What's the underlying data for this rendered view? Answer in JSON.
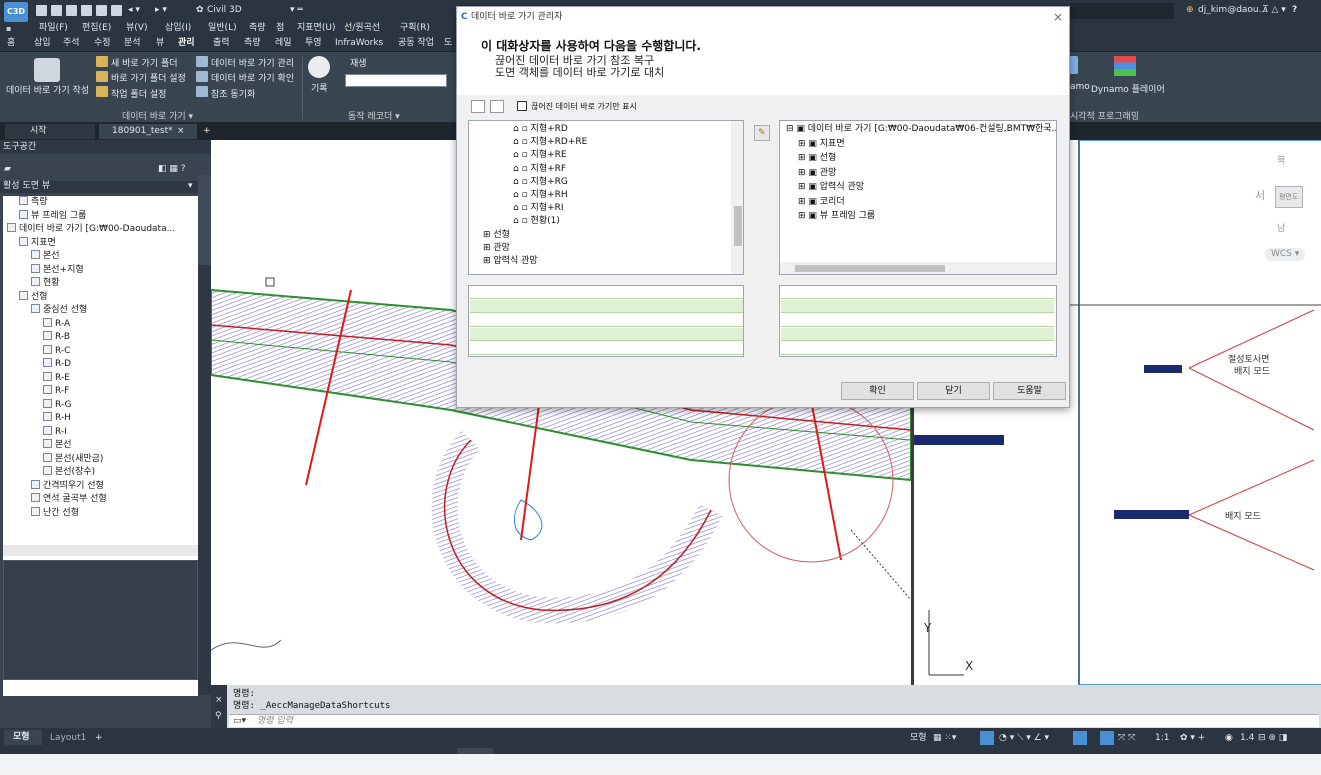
{
  "app": {
    "title": "Civil 3D",
    "logo": "C3D",
    "user": "dj_kim@daou...",
    "help": "?"
  },
  "menu": [
    "파일(F)",
    "편집(E)",
    "뷰(V)",
    "삽입(I)",
    "일반(L)",
    "측량",
    "점",
    "지표면(U)",
    "선/원곡선",
    "구획(R)"
  ],
  "ribbon_tabs": [
    "홈",
    "삽입",
    "주석",
    "수정",
    "분석",
    "뷰",
    "관리",
    "출력",
    "측량",
    "레일",
    "투영",
    "InfraWorks",
    "공동 작업",
    "도"
  ],
  "ribbon": {
    "big_button": "데이터 바로 가기 작성",
    "col1": [
      "새 바로 가기 폴더",
      "바로 가기 폴더 설정",
      "작업 폴더 설정"
    ],
    "col2": [
      "데이터 바로 가기 관리",
      "데이터 바로 가기 확인",
      "참조 동기화"
    ],
    "panel_label": "데이터 바로 가기 ▾",
    "record_label": "기록",
    "play_label": "재생",
    "action_recorder": "동작 레코더 ▾",
    "dynamo_label": "amo",
    "dynamo_player": "Dynamo 플레이어",
    "visual_programming": "시각적 프로그래밍"
  },
  "file_tabs": {
    "start": "시작",
    "doc": "180901_test*",
    "close": "×",
    "add": "+"
  },
  "toolspace": {
    "title": "도구공간",
    "view": "활성 도면 뷰",
    "tree": [
      {
        "label": "측량",
        "indent": 1
      },
      {
        "label": "뷰 프레임 그룹",
        "indent": 1
      },
      {
        "label": "데이터 바로 가기 [G:₩00-Daoudata...",
        "indent": 0
      },
      {
        "label": "지표면",
        "indent": 1
      },
      {
        "label": "본선",
        "indent": 2
      },
      {
        "label": "본선+지형",
        "indent": 2
      },
      {
        "label": "현황",
        "indent": 2
      },
      {
        "label": "선형",
        "indent": 1
      },
      {
        "label": "중심선 선형",
        "indent": 2
      },
      {
        "label": "R-A",
        "indent": 3
      },
      {
        "label": "R-B",
        "indent": 3
      },
      {
        "label": "R-C",
        "indent": 3
      },
      {
        "label": "R-D",
        "indent": 3
      },
      {
        "label": "R-E",
        "indent": 3
      },
      {
        "label": "R-F",
        "indent": 3
      },
      {
        "label": "R-G",
        "indent": 3
      },
      {
        "label": "R-H",
        "indent": 3
      },
      {
        "label": "R-I",
        "indent": 3
      },
      {
        "label": "본선",
        "indent": 3
      },
      {
        "label": "본선(새만금)",
        "indent": 3
      },
      {
        "label": "본선(장수)",
        "indent": 3
      },
      {
        "label": "간격띄우기 선형",
        "indent": 2
      },
      {
        "label": "연석 굴곡부 선형",
        "indent": 2
      },
      {
        "label": "난간 선형",
        "indent": 2
      }
    ]
  },
  "dialog": {
    "title": "데이터 바로 가기 관리자",
    "heading": "이 대화상자를 사용하여 다음을 수행합니다.",
    "line1": "끊어진 데이터 바로 가기 참조 복구",
    "line2": "도면 객체를 데이터 바로 가기로 대치",
    "checkbox": "끊어진 데이터 바로 가기만 표시",
    "left_tree": [
      "지형+RD",
      "지형+RD+RE",
      "지형+RE",
      "지형+RF",
      "지형+RG",
      "지형+RH",
      "지형+RI",
      "현황(1)",
      "선형",
      "관망",
      "압력식 관망"
    ],
    "right_tree": [
      "데이터 바로 가기 [G:₩00-Daoudata₩06-컨설팅,BMT₩한국...",
      "지표면",
      "선형",
      "관망",
      "압력식 관망",
      "코리더",
      "뷰 프레임 그룹"
    ],
    "ok": "확인",
    "close": "닫기",
    "help": "도움말"
  },
  "viewcube": {
    "north": "북",
    "west": "서",
    "south": "남",
    "top": "평면도",
    "wcs": "WCS ▾"
  },
  "drawing_labels": {
    "label1": "절성토사면",
    "label2": "배지 모드",
    "label3": "배지 모드",
    "ucs_y": "Y",
    "ucs_x": "X"
  },
  "command": {
    "line1": "명령:",
    "line2": "명령: _AeccManageDataShortcuts",
    "placeholder": "명령 입력"
  },
  "status": {
    "model_tab": "모형",
    "layout_tab": "Layout1",
    "add": "+",
    "model": "모형",
    "scale": "1:1",
    "value": "1.4"
  },
  "colors": {
    "accent": "#4a8fd4",
    "alignment_red": "#d11a1a",
    "hatch": "#8a7fd1",
    "grid_green": "#2d8f2d"
  }
}
